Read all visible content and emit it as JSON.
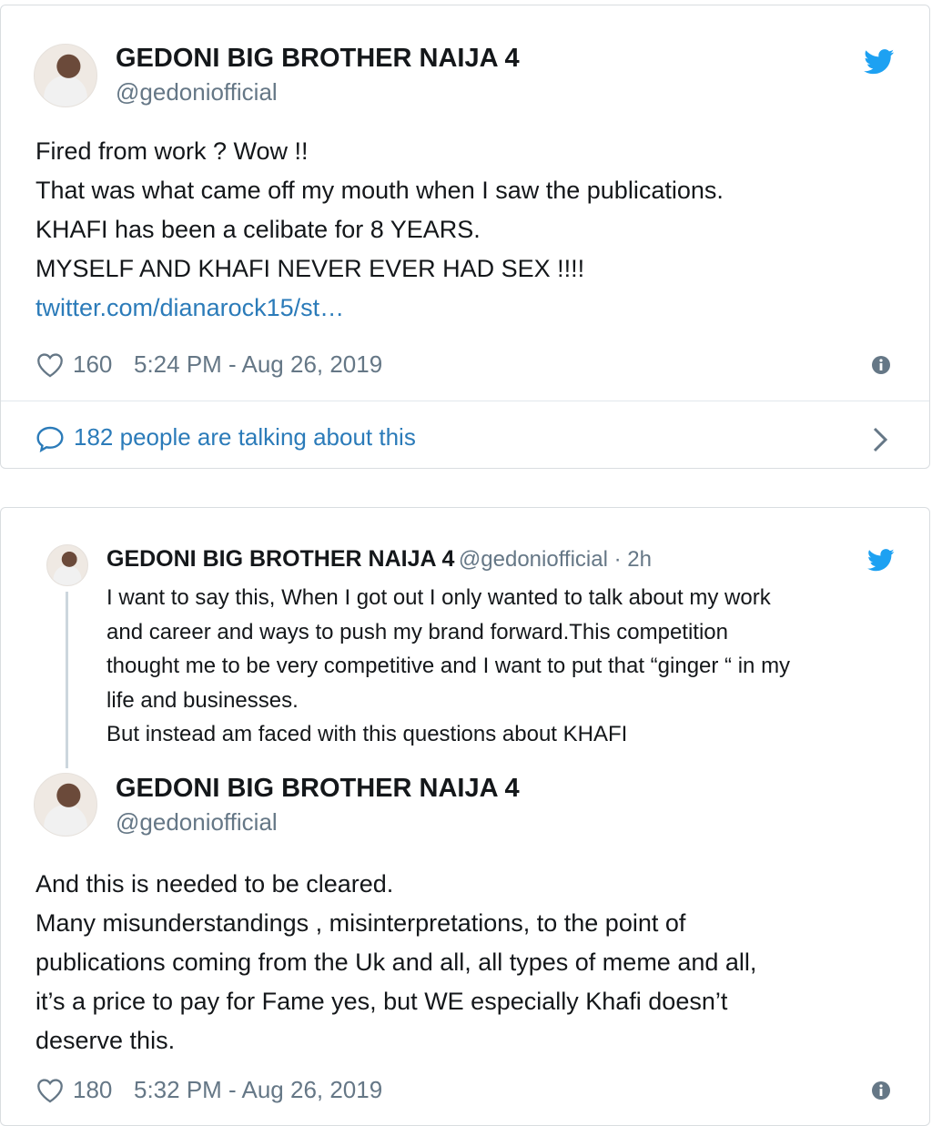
{
  "tweet1": {
    "name": "GEDONI BIG BROTHER NAIJA 4",
    "handle": "@gedoniofficial",
    "lines": [
      "Fired from work ? Wow !!",
      "That was what came off my mouth when I saw the publications.",
      "KHAFI has been a celibate for 8 YEARS.",
      "MYSELF AND KHAFI NEVER EVER HAD SEX !!!!"
    ],
    "link": "twitter.com/dianarock15/st…",
    "likes": "160",
    "timestamp": "5:24 PM - Aug 26, 2019",
    "talking": "182 people are talking about this"
  },
  "quoted": {
    "name": "GEDONI BIG BROTHER NAIJA 4",
    "handle": "@gedoniofficial · 2h",
    "lines": [
      "I want to say this, When I got out I only wanted to talk about my work",
      "and career and ways to push my brand forward.This competition",
      "thought me to be very competitive and I want to put that “ginger “ in my",
      "life and businesses.",
      "But instead am faced with this questions about KHAFI"
    ]
  },
  "tweet2": {
    "name": "GEDONI BIG BROTHER NAIJA 4",
    "handle": "@gedoniofficial",
    "lines": [
      "And this is needed to be cleared.",
      "Many misunderstandings , misinterpretations, to the point of",
      "publications coming from the Uk and all, all types of meme and all,",
      "it’s a price to pay for Fame yes, but WE especially Khafi doesn’t",
      "deserve this."
    ],
    "likes": "180",
    "timestamp": "5:32 PM - Aug 26, 2019"
  },
  "colors": {
    "twitter_blue": "#1da1f2",
    "link": "#2b7bb9",
    "secondary_text": "#657786"
  },
  "icons": [
    "twitter-bird-icon",
    "heart-icon",
    "info-icon",
    "speech-bubble-icon",
    "chevron-right-icon"
  ]
}
